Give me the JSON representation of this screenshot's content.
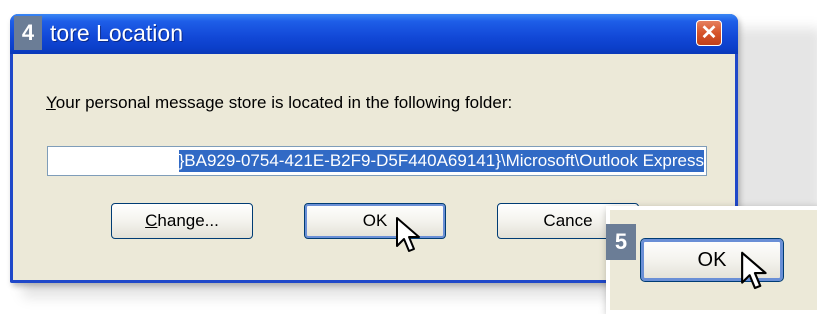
{
  "dialog": {
    "title": "tore Location",
    "message_pre": "",
    "message_underlined": "Y",
    "message_post": "our personal message store is located in the following folder:",
    "path_value": "}BA929-0754-421E-B2F9-D5F440A69141}\\Microsoft\\Outlook Express",
    "close_glyph": "✕"
  },
  "buttons": {
    "change_accel": "C",
    "change_rest": "hange...",
    "ok_label": "OK",
    "cancel_label": "Cance"
  },
  "steps": {
    "step4": "4",
    "step5": "5"
  },
  "zoom": {
    "ok_label": "OK"
  },
  "icons": {
    "close": "close-icon",
    "cursor": "cursor-arrow-icon"
  },
  "colors": {
    "titlebar": "#0b3fc9",
    "selection": "#316ac5",
    "close": "#d6542a",
    "badge": "#6b7d96"
  }
}
